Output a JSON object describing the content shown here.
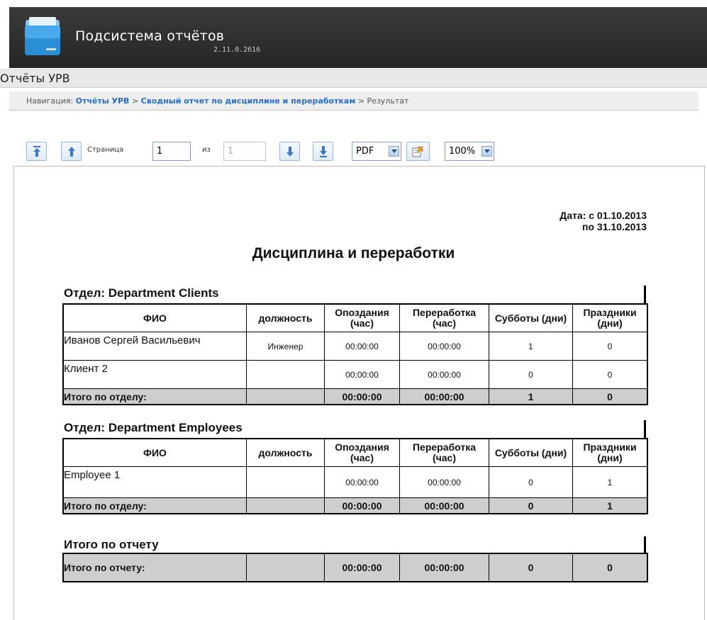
{
  "app": {
    "title": "Подсистема отчётов",
    "version": "2.11.0.2616"
  },
  "section": {
    "title": "Отчёты УРВ"
  },
  "breadcrumb": {
    "prefix": "Навигация:",
    "item1": "Отчёты УРВ",
    "sep1": ">",
    "item2": "Сводный отчет по дисциплине и переработкам",
    "sep2": ">",
    "current": "Результат"
  },
  "toolbar": {
    "page_label": "Страница",
    "page_value": "1",
    "of_label": "из",
    "total_pages": "1",
    "format": "PDF",
    "zoom": "100%"
  },
  "report": {
    "date_line1": "Дата: с 01.10.2013",
    "date_line2": "по 31.10.2013",
    "title": "Дисциплина и переработки",
    "columns": [
      "ФИО",
      "должность",
      "Опоздания (час)",
      "Переработка (час)",
      "Субботы (дни)",
      "Праздники (дни)"
    ],
    "departments": [
      {
        "title": "Отдел: Department Clients",
        "rows": [
          [
            "Иванов Сергей Васильевич",
            "Инженер",
            "00:00:00",
            "00:00:00",
            "1",
            "0"
          ],
          [
            "Клиент 2",
            "",
            "00:00:00",
            "00:00:00",
            "0",
            "0"
          ]
        ],
        "total": [
          "Итого по отделу:",
          "",
          "00:00:00",
          "00:00:00",
          "1",
          "0"
        ]
      },
      {
        "title": "Отдел: Department Employees",
        "rows": [
          [
            "Employee 1",
            "",
            "00:00:00",
            "00:00:00",
            "0",
            "1"
          ]
        ],
        "total": [
          "Итого по отделу:",
          "",
          "00:00:00",
          "00:00:00",
          "0",
          "1"
        ]
      }
    ],
    "grand_total_title": "Итого по отчету",
    "grand_total": [
      "Итого по отчету:",
      "",
      "00:00:00",
      "00:00:00",
      "0",
      "0"
    ]
  }
}
